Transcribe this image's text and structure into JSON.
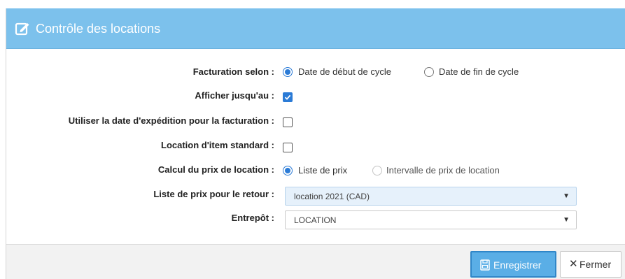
{
  "dialog": {
    "title": "Contrôle des locations",
    "header_icon": "edit-icon",
    "header_color": "#7cc1ec"
  },
  "form": {
    "billing": {
      "label": "Facturation selon :",
      "options": [
        {
          "label": "Date de début de cycle",
          "checked": true
        },
        {
          "label": "Date de fin de cycle",
          "checked": false
        }
      ]
    },
    "show_until": {
      "label": "Afficher jusqu'au :",
      "checked": true
    },
    "use_ship_date": {
      "label": "Utiliser la date d'expédition pour la facturation :",
      "checked": false
    },
    "standard_item": {
      "label": "Location d'item standard :",
      "checked": false
    },
    "price_calc": {
      "label": "Calcul du prix de location :",
      "options": [
        {
          "label": "Liste de prix",
          "checked": true
        },
        {
          "label": "Intervalle de prix de location",
          "checked": false
        }
      ]
    },
    "return_price_list": {
      "label": "Liste de prix pour le retour :",
      "value": "location 2021 (CAD)"
    },
    "warehouse": {
      "label": "Entrepôt :",
      "value": "LOCATION"
    }
  },
  "footer": {
    "save_label": "Enregistrer",
    "close_label": "Fermer",
    "accent_color": "#5aaee6"
  }
}
